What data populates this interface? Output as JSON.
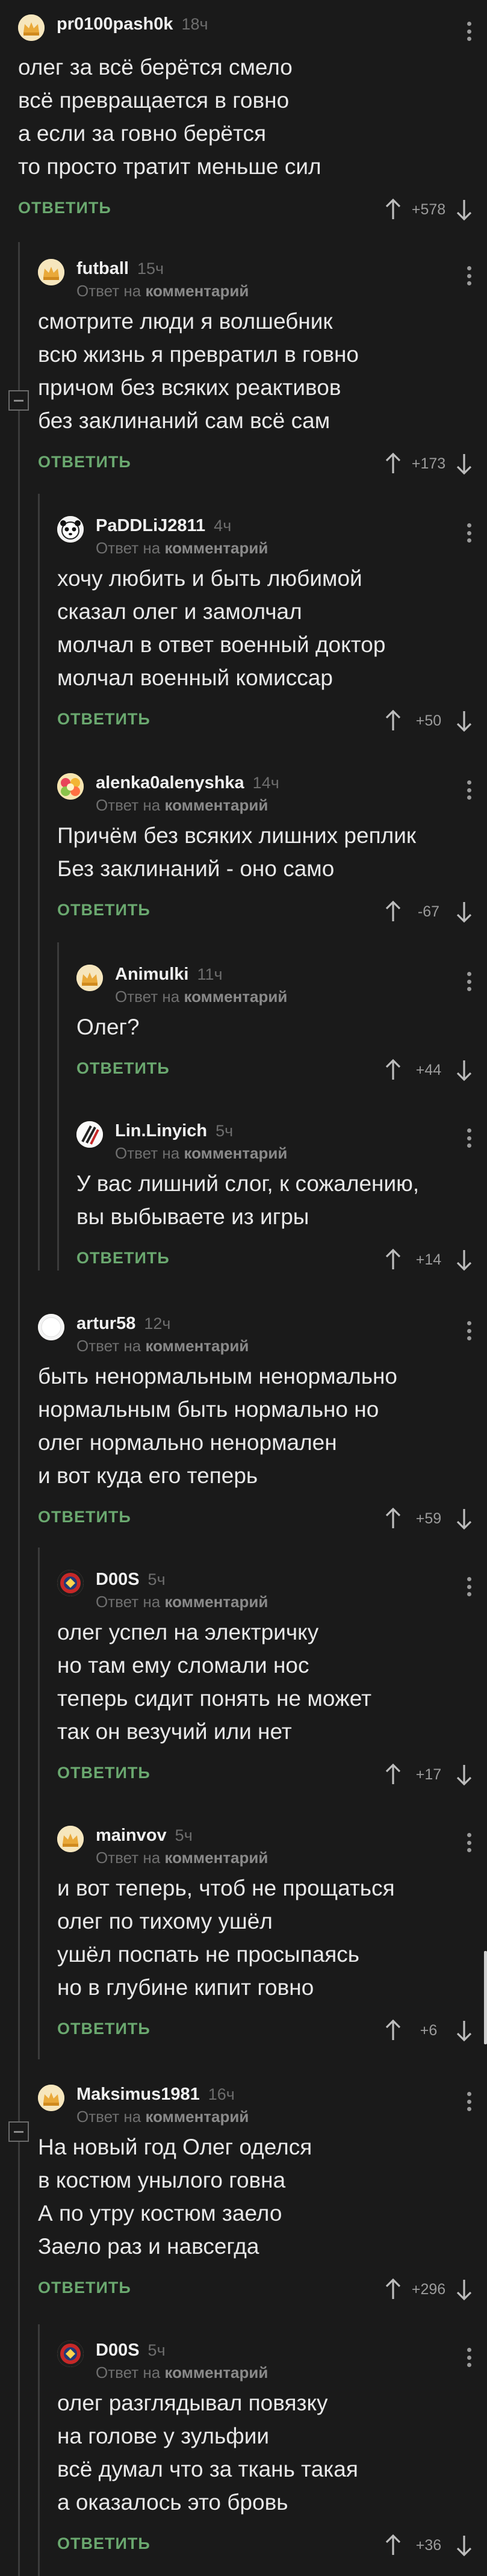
{
  "labels": {
    "reply": "ОТВЕТИТЬ",
    "reply_on": "Ответ на",
    "comment_word": "комментарий"
  },
  "colors": {
    "background": "#1a1a1a",
    "reply_green": "#6aa86f",
    "text": "#e8e8e8",
    "muted": "#6f6f6f"
  },
  "comments": [
    {
      "user": "pr0100pash0k",
      "time": "18ч",
      "is_reply": false,
      "avatar": "pikabu-default",
      "text": "олег за всё берётся смело\nвсё превращается в говно\nа если за говно берётся\nто просто тратит меньше сил",
      "rating": "+578"
    },
    {
      "user": "futball",
      "time": "15ч",
      "is_reply": true,
      "avatar": "pikabu-default",
      "text": "смотрите люди я волшебник\nвсю жизнь я превратил в говно\nпричом без всяких реактивов\nбез заклинаний сам всё сам",
      "rating": "+173"
    },
    {
      "user": "PaDDLiJ2811",
      "time": "4ч",
      "is_reply": true,
      "avatar": "panda-face",
      "text": "хочу любить и быть любимой\nсказал олег и замолчал\nмолчал в ответ военный доктор\nмолчал военный комиссар",
      "rating": "+50"
    },
    {
      "user": "alenka0alenyshka",
      "time": "14ч",
      "is_reply": true,
      "avatar": "flower",
      "text": "Причём без всяких лишних реплик\n Без заклинаний - оно само",
      "rating": "-67"
    },
    {
      "user": "Animulki",
      "time": "11ч",
      "is_reply": true,
      "avatar": "pikabu-default",
      "text": "Олег?",
      "rating": "+44"
    },
    {
      "user": "Lin.Linyich",
      "time": "5ч",
      "is_reply": true,
      "avatar": "claw-scratches",
      "text": "У вас лишний слог, к сожалению,\nвы выбываете из игры",
      "rating": "+14"
    },
    {
      "user": "artur58",
      "time": "12ч",
      "is_reply": true,
      "avatar": "white-blank",
      "text": "быть ненормальным ненормально\nнормальным быть нормально но\nолег нормально ненормален\nи вот куда его теперь",
      "rating": "+59"
    },
    {
      "user": "D00S",
      "time": "5ч",
      "is_reply": true,
      "avatar": "red-badge",
      "text": "олег успел на электричку\nно там ему сломали нос\nтеперь сидит понять не может\nтак он везучий или нет",
      "rating": "+17"
    },
    {
      "user": "mainvov",
      "time": "5ч",
      "is_reply": true,
      "avatar": "pikabu-default",
      "text": "и вот теперь, чтоб не прощаться\nолег по тихому ушёл\nушёл поспать не просыпаясь\nно в глубине кипит говно",
      "rating": "+6"
    },
    {
      "user": "Maksimus1981",
      "time": "16ч",
      "is_reply": true,
      "avatar": "pikabu-default",
      "text": "На новый год Олег оделся\nв костюм унылого говна\nА по утру костюм заело\nЗаело раз и навсегда",
      "rating": "+296"
    },
    {
      "user": "D00S",
      "time": "5ч",
      "is_reply": true,
      "avatar": "red-badge",
      "text": "олег разглядывал повязку\nна голове у зульфии\nвсё думал что за ткань такая\nа оказалось это бровь",
      "rating": "+36"
    }
  ]
}
